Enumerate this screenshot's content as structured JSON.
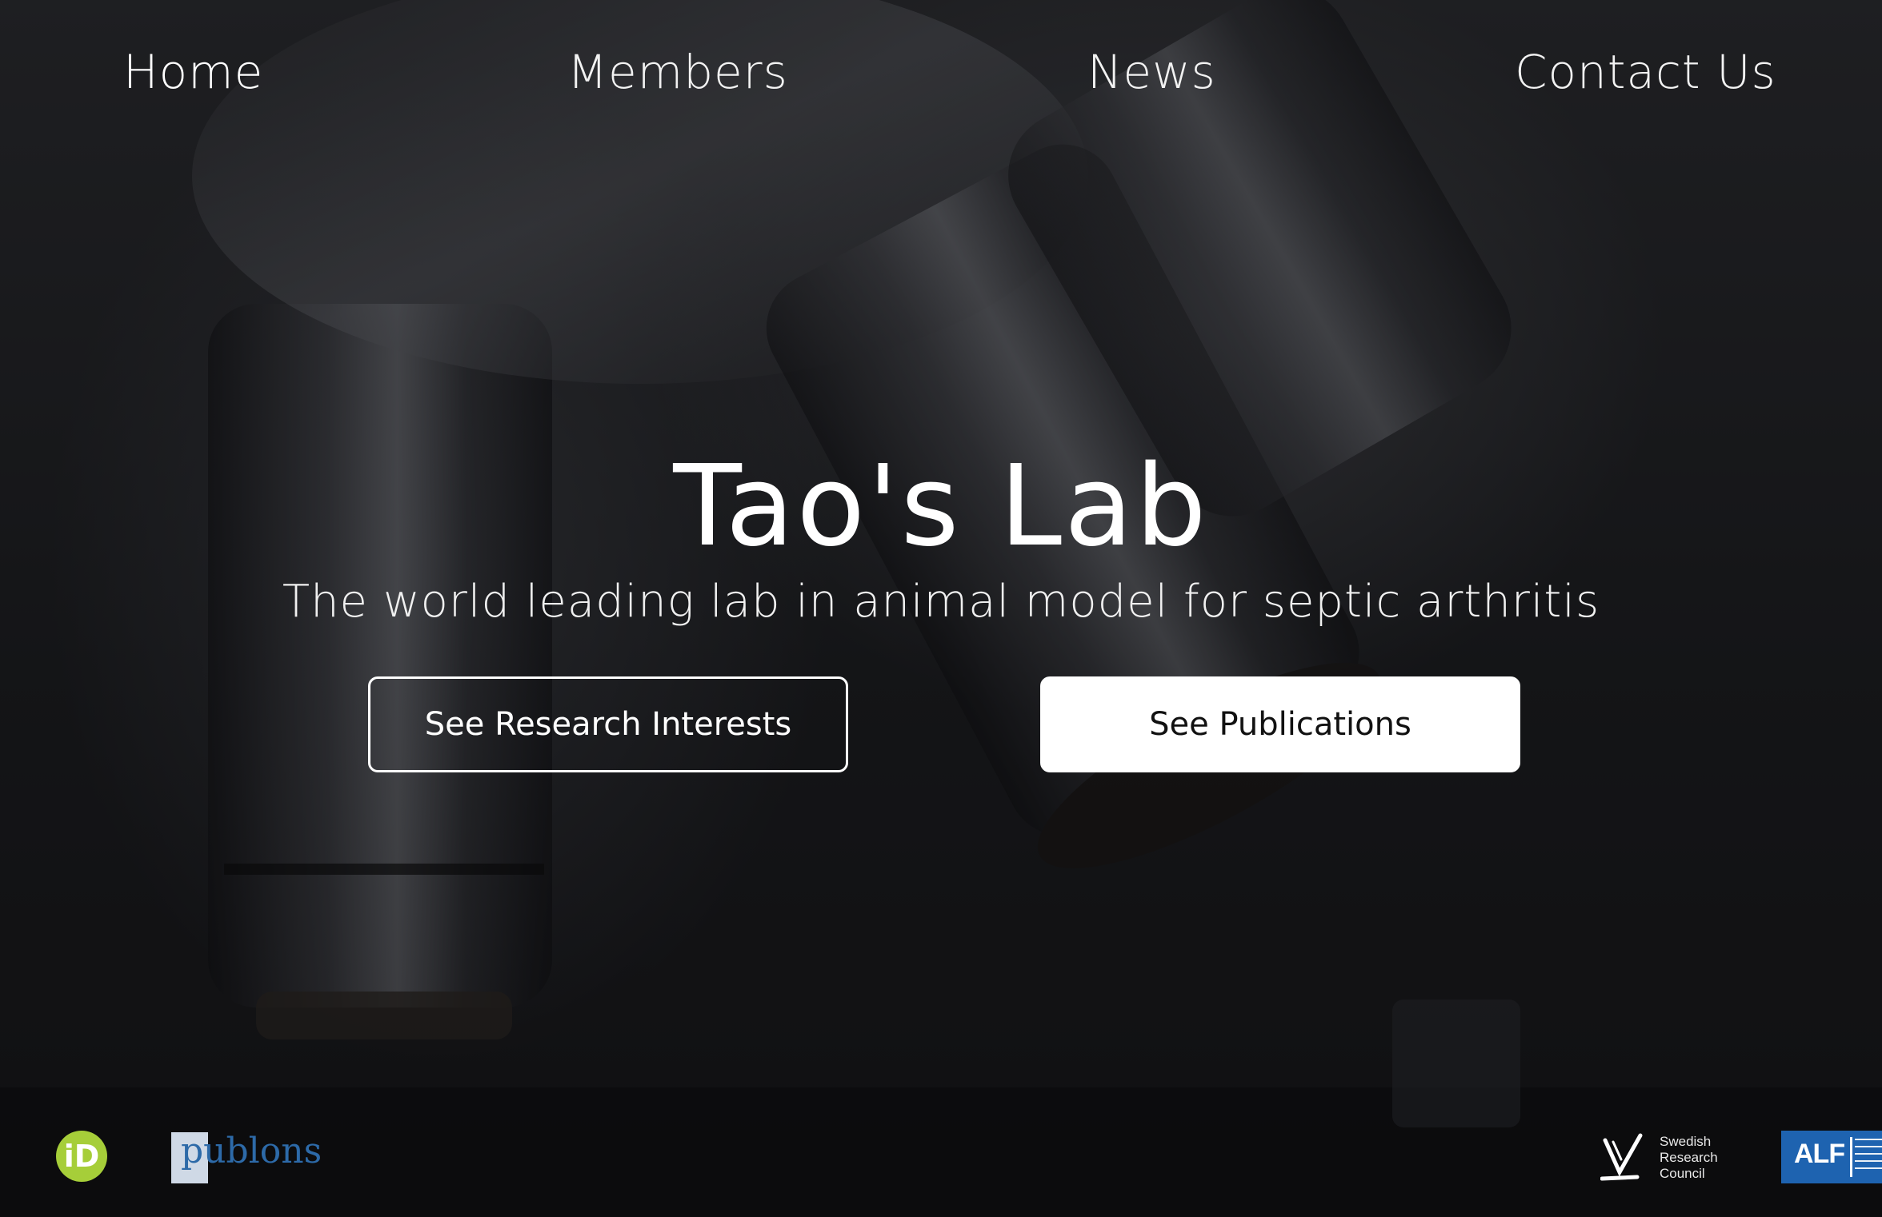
{
  "nav": {
    "home": "Home",
    "members": "Members",
    "news": "News",
    "contact": "Contact Us"
  },
  "hero": {
    "title": "Tao's Lab",
    "subtitle": "The world leading lab in animal model for septic arthritis",
    "buttons": {
      "research": "See Research Interests",
      "publications": "See Publications"
    }
  },
  "footer": {
    "orcid": "iD",
    "publons": "publons",
    "vr": [
      "Swedish",
      "Research",
      "Council"
    ],
    "alf": "ALF"
  },
  "colors": {
    "orcid_green": "#a6ce39",
    "publons_blue": "#2d6aa8",
    "alf_blue": "#1e63b0",
    "button_outline": "#ffffff"
  }
}
